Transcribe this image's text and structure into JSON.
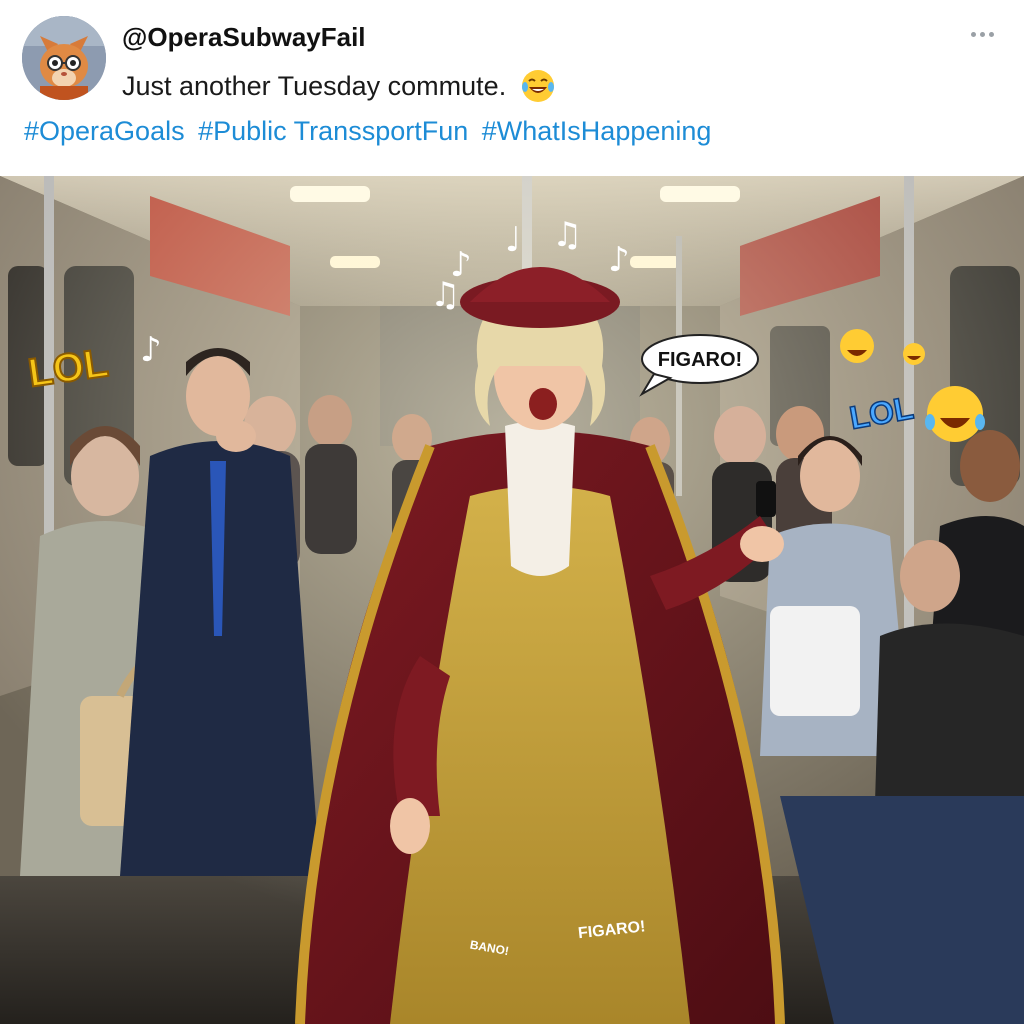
{
  "post": {
    "username": "@OperaSubwayFail",
    "caption": "Just another Tuesday commute.",
    "caption_emoji": "laughing-tears-emoji",
    "hashtags": [
      "#OperaGoals",
      "#Public TranssportFun",
      "#WhatIsHappening"
    ],
    "more_icon": "more-options-icon"
  },
  "photo": {
    "stickers": {
      "lol_left": "LOL",
      "lol_right": "LOL",
      "figaro_bubble": "FIGARO!",
      "dress_text_1": "FIGARO!",
      "dress_text_2": "BANO!"
    }
  },
  "colors": {
    "hashtag": "#1d8cd6",
    "username": "#111111",
    "lol_left": "#f5c518",
    "lol_right": "#4aa8ff"
  }
}
